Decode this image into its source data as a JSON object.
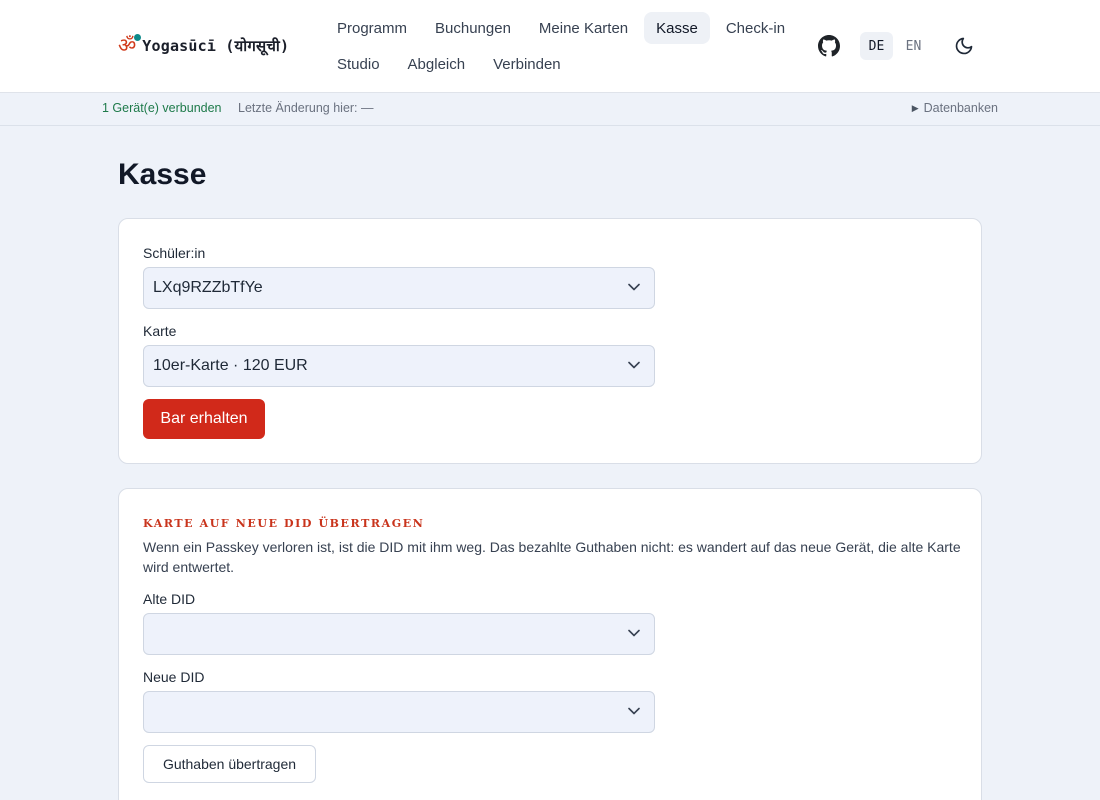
{
  "header": {
    "brand": "Yogasūcī (योगसूची)",
    "brand_symbol": "ॐ",
    "nav_row1": [
      "Programm",
      "Buchungen",
      "Meine Karten",
      "Kasse",
      "Check-in"
    ],
    "nav_row2": [
      "Studio",
      "Abgleich",
      "Verbinden"
    ],
    "active_nav": "Kasse",
    "languages": [
      "DE",
      "EN"
    ],
    "active_language": "DE",
    "icons": [
      "github-icon",
      "moon-icon"
    ]
  },
  "status": {
    "devices": "1 Gerät(e) verbunden",
    "last_change": "Letzte Änderung hier: —",
    "databases": "Datenbanken"
  },
  "page": {
    "title": "Kasse"
  },
  "checkout": {
    "student_label": "Schüler:in",
    "student_value": "LXq9RZZbTfYe",
    "card_label": "Karte",
    "card_value": "10er-Karte · 120 EUR",
    "submit_label": "Bar erhalten"
  },
  "transfer": {
    "title": "Karte auf neue DID übertragen",
    "description": "Wenn ein Passkey verloren ist, ist die DID mit ihm weg. Das bezahlte Guthaben nicht: es wandert auf das neue Gerät, die alte Karte wird entwertet.",
    "old_did_label": "Alte DID",
    "old_did_value": "",
    "new_did_label": "Neue DID",
    "new_did_value": "",
    "submit_label": "Guthaben übertragen"
  },
  "colors": {
    "accent": "#d1291a",
    "status_ok": "#1e7a4a",
    "background": "#eef2f9"
  }
}
